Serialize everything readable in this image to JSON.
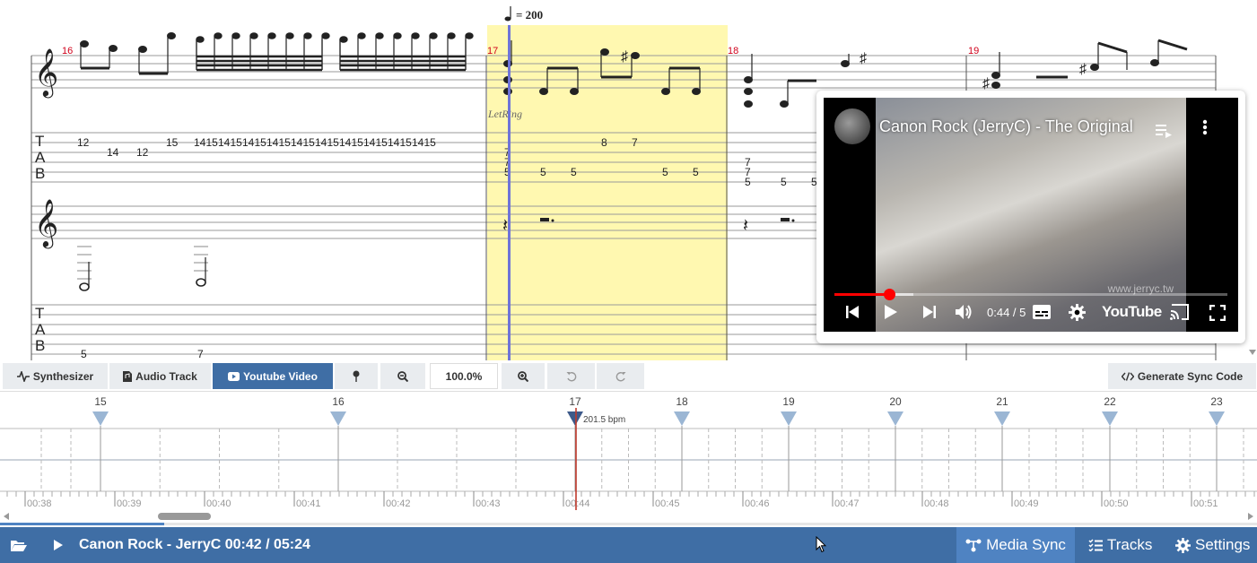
{
  "score": {
    "tempo_value": "200",
    "bar_numbers": [
      "16",
      "17",
      "18",
      "19"
    ],
    "let_ring_label": "LetRing",
    "tab_letters": [
      "T",
      "A",
      "B"
    ],
    "tab1_bar16": [
      "12",
      "14",
      "12",
      "15",
      "14",
      "15",
      "14",
      "15",
      "14",
      "15",
      "14",
      "15",
      "14",
      "15",
      "14",
      "15",
      "14",
      "15",
      "14",
      "15",
      "14",
      "15",
      "14",
      "15"
    ],
    "tab1_bar17": [
      "7",
      "7",
      "5",
      "5",
      "5",
      "8",
      "7",
      "5",
      "5"
    ],
    "tab1_bar18": [
      "7",
      "7",
      "5",
      "5",
      "5"
    ],
    "tab2_bar16": [
      "5",
      "7"
    ]
  },
  "video": {
    "title": "Canon Rock (JerryC) - The Original",
    "time": "0:44 / 5",
    "brand": "YouTube",
    "progress": 0.14,
    "buffer": 0.2,
    "watermark": "www.jerryc.tw",
    "icons": [
      "playlist-icon",
      "more-icon",
      "previous-icon",
      "play-icon",
      "next-icon",
      "volume-icon",
      "captions-icon",
      "settings-icon",
      "cast-icon",
      "fullscreen-icon"
    ]
  },
  "toolbar": {
    "synth_label": "Synthesizer",
    "audio_label": "Audio Track",
    "youtube_label": "Youtube Video",
    "zoom_value": "100.0%",
    "generate_label": "Generate Sync Code"
  },
  "timeline": {
    "bar_markers": [
      "15",
      "16",
      "17",
      "18",
      "19",
      "20",
      "21",
      "22",
      "23"
    ],
    "bpm_label": "201.5 bpm",
    "time_labels": [
      "00:38",
      "00:39",
      "00:40",
      "00:41",
      "00:42",
      "00:43",
      "00:44",
      "00:45",
      "00:46",
      "00:47",
      "00:48",
      "00:49",
      "00:50",
      "00:51"
    ]
  },
  "status": {
    "song_title": "Canon Rock - JerryC",
    "current_time": "00:42",
    "total_time": "05:24",
    "media_sync_label": "Media Sync",
    "tracks_label": "Tracks",
    "settings_label": "Settings"
  },
  "colors": {
    "accent": "#3f6ea5",
    "highlight": "#fff8b0",
    "cursor": "#6f74d8",
    "bar_number": "#d0021b",
    "marker": "#9bb6d4",
    "marker_active": "#3d5a8a",
    "playhead": "#c0392b"
  }
}
